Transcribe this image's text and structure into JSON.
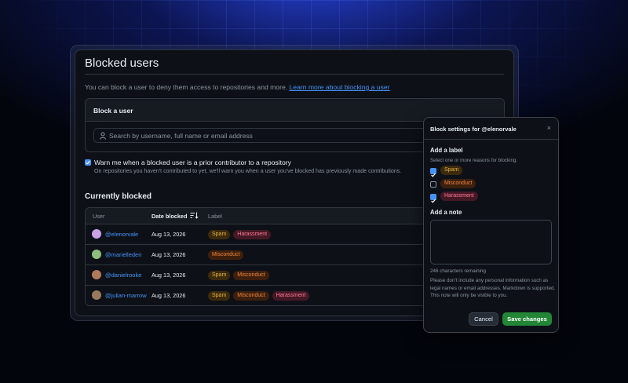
{
  "page": {
    "title": "Blocked users",
    "intro_text": "You can block a user to deny them access to repositories and more. ",
    "intro_link": "Learn more about blocking a user"
  },
  "block_user": {
    "heading": "Block a user",
    "search_placeholder": "Search by username, full name or email address",
    "warn_checked": true,
    "warn_label": "Warn me when a blocked user is a prior contributor to a repository",
    "warn_help": "On repositories you haven't contributed to yet, we'll warn you when a user you've blocked has previously made contributions."
  },
  "currently_blocked": {
    "heading": "Currently blocked",
    "columns": [
      "User",
      "Date blocked",
      "Label"
    ],
    "rows": [
      {
        "user": "@elenorvale",
        "date": "Aug 13, 2026",
        "labels": [
          "Spam",
          "Harassment"
        ],
        "avatar_color": "#c9a3e6"
      },
      {
        "user": "@marielleden",
        "date": "Aug 13, 2026",
        "labels": [
          "Misconduct"
        ],
        "avatar_color": "#8fbf7f"
      },
      {
        "user": "@danielrooke",
        "date": "Aug 13, 2026",
        "labels": [
          "Spam",
          "Misconduct"
        ],
        "avatar_color": "#b07a5a"
      },
      {
        "user": "@julian-marrow",
        "date": "Aug 13, 2026",
        "labels": [
          "Spam",
          "Misconduct",
          "Harassment"
        ],
        "avatar_color": "#9a7a5e"
      }
    ]
  },
  "popover": {
    "title": "Block settings for @elenorvale",
    "close": "×",
    "add_label_heading": "Add a label",
    "add_label_hint": "Select one or more reasons for blocking.",
    "options": [
      {
        "label": "Spam",
        "checked": true
      },
      {
        "label": "Misconduct",
        "checked": false
      },
      {
        "label": "Harassment",
        "checked": true
      }
    ],
    "add_note_heading": "Add a note",
    "note_value": "",
    "chars_remaining": "246 characters remaining",
    "disclaimer": "Please don't include any personal information such as legal names or email addresses. Markdown is supported. This note will only be visible to you.",
    "cancel_label": "Cancel",
    "save_label": "Save changes"
  },
  "colors": {
    "accent": "#4493f8",
    "save": "#238636",
    "spam": "#e3b341",
    "misconduct": "#f0883e",
    "harassment": "#ff7b9c"
  }
}
